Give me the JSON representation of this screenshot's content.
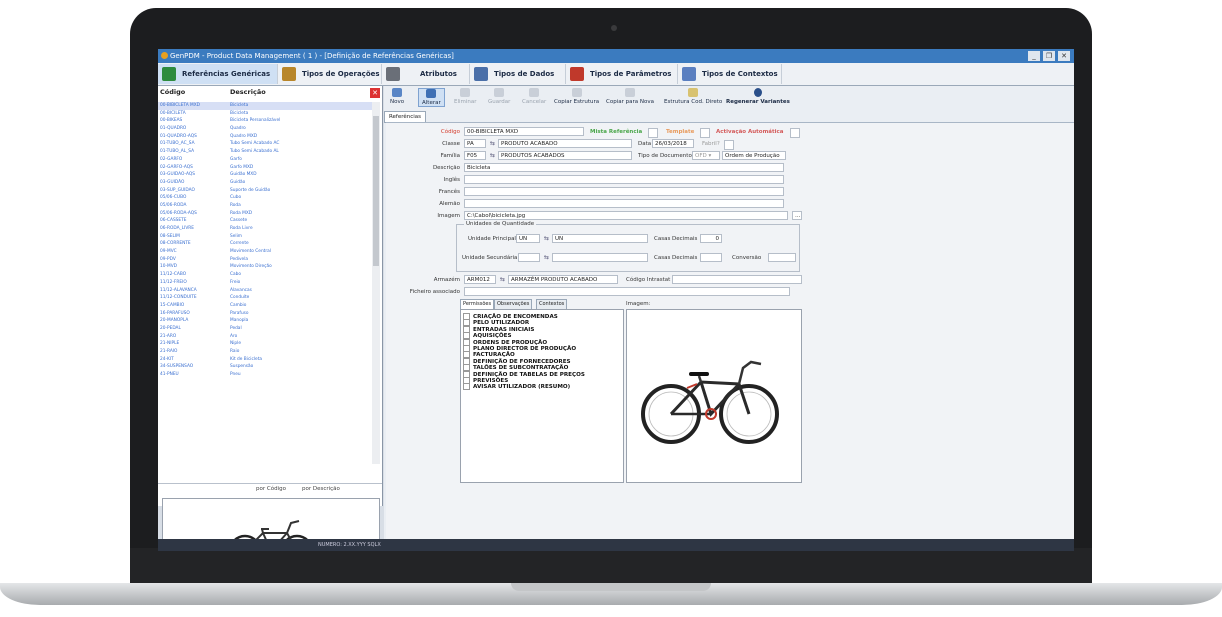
{
  "window": {
    "title": "GenPDM - Product Data Management ( 1 ) - [Definição de Referências Genéricas]",
    "controls": [
      "_",
      "❐",
      "✕"
    ]
  },
  "tabs": [
    {
      "label": "Referências Genéricas",
      "color": "#2e8b3e"
    },
    {
      "label": "Tipos de Operações",
      "color": "#b8862a"
    },
    {
      "label": "Atributos",
      "color": "#6a6f78"
    },
    {
      "label": "Tipos de Dados",
      "color": "#4a6fa8"
    },
    {
      "label": "Tipos de Parâmetros",
      "color": "#c0392b"
    },
    {
      "label": "Tipos de Contextos",
      "color": "#5a7fc0"
    }
  ],
  "left": {
    "col_code": "Código",
    "col_desc": "Descrição",
    "rows": [
      [
        "00-BIBICLETA MXD",
        "Bicicleta"
      ],
      [
        "00-BICILETA",
        "Bicicleta"
      ],
      [
        "00-BIKEAS",
        "Bicicleta Personalizável"
      ],
      [
        "01-QUADRO",
        "Quadro"
      ],
      [
        "01-QUADRO-AQS",
        "Quadro MXD"
      ],
      [
        "01-TUBO_AC_SA",
        "Tubo Semi Acabado AC"
      ],
      [
        "01-TUBO_AL_SA",
        "Tubo Semi Acabado AL"
      ],
      [
        "02-GARFO",
        "Garfo"
      ],
      [
        "02-GARFO-AQS",
        "Garfo MXD"
      ],
      [
        "03-GUIDAO-AQS",
        "Guidão MXD"
      ],
      [
        "03-GUIDÃO",
        "Guidão"
      ],
      [
        "03-SUP_GUIDAO",
        "Suporte de Guidão"
      ],
      [
        "05/06-CUBO",
        "Cubo"
      ],
      [
        "05/06-RODA",
        "Roda"
      ],
      [
        "05/06-RODA-AQS",
        "Roda MXD"
      ],
      [
        "06-CASSETE",
        "Cassete"
      ],
      [
        "06-RODA_LIVRE",
        "Roda Livre"
      ],
      [
        "08-SELIM",
        "Selim"
      ],
      [
        "08-CORRENTE",
        "Corrente"
      ],
      [
        "09-MVC",
        "Movimento Central"
      ],
      [
        "09-PDV",
        "Pedivela"
      ],
      [
        "10-MVD",
        "Movimento Direção"
      ],
      [
        "11/12-CABO",
        "Cabo"
      ],
      [
        "11/12-FREIO",
        "Freio"
      ],
      [
        "11/12-ALAVANCA",
        "Alavancas"
      ],
      [
        "11/12-CONDUITE",
        "Conduíte"
      ],
      [
        "15-CAMBIO",
        "Cambio"
      ],
      [
        "16-PARAFUSO",
        "Parafuso"
      ],
      [
        "20-MANOPLA",
        "Manopla"
      ],
      [
        "20-PEDAL",
        "Pedal"
      ],
      [
        "21-ARO",
        "Aro"
      ],
      [
        "21-NIPLE",
        "Niple"
      ],
      [
        "21-RAIO",
        "Raio"
      ],
      [
        "24-KIT",
        "Kit de Bicicleta"
      ],
      [
        "34-SUSPENSAO",
        "Suspensão"
      ],
      [
        "41-PNEU",
        "Pneu"
      ]
    ],
    "sort_code": "por Código",
    "sort_desc": "por Descrição"
  },
  "toolbar": {
    "items": [
      "Novo",
      "Alterar",
      "Eliminar",
      "Guardar",
      "Cancelar",
      "Copiar Estrutura",
      "Copiar para Nova",
      "Estrutura Cod. Direto",
      "Regenerar Variantes"
    ],
    "subtab": "Referências"
  },
  "form": {
    "codigo_label": "Código",
    "codigo": "00-BIBICLETA MXD",
    "mista_label": "Mista Referência",
    "template_label": "Template",
    "ativacao_label": "Activação Automática",
    "classe_label": "Classe",
    "classe_code": "PA",
    "classe_desc": "PRODUTO ACABADO",
    "data_label": "Data",
    "data": "26/03/2018",
    "fabril_label": "Fabril?",
    "familia_label": "Família",
    "familia_code": "F05",
    "familia_desc": "PRODUTOS ACABADOS",
    "tipodoc_label": "Tipo de Documento",
    "tipodoc_code": "OFD",
    "tipodoc_desc": "Ordem de Produção",
    "descricao_label": "Descrição",
    "descricao": "Bicicleta",
    "ingles_label": "Inglês",
    "frances_label": "Francês",
    "alemao_label": "Alemão",
    "imagem_label": "Imagem",
    "imagem": "C:\\Cabol\\bicicleta.jpg",
    "unidades_title": "Unidades de Quantidade",
    "unid_principal_label": "Unidade Principal",
    "unid_principal": "UN",
    "unid_principal_desc": "UN",
    "casas_label": "Casas Decimais",
    "casas_principal": "0",
    "unid_secundaria_label": "Unidade Secundária",
    "conversao_label": "Conversão",
    "armazem_label": "Armazém",
    "armazem_code": "ARM012",
    "armazem_desc": "ARMAZÉM PRODUTO ACABADO",
    "codigo_intrastat_label": "Código Intrastat",
    "ficheiro_label": "Ficheiro associado",
    "imagem_title": "Imagem:",
    "ptabs": [
      "Permissões",
      "Observações",
      "Contextos"
    ],
    "permissions": [
      "CRIAÇÃO DE ENCOMENDAS",
      "PELO UTILIZADOR",
      "ENTRADAS INICIAIS",
      "AQUISIÇÕES",
      "ORDENS DE PRODUÇÃO",
      "PLANO DIRECTOR DE PRODUÇÃO",
      "FACTURAÇÃO",
      "DEFINIÇÃO DE FORNECEDORES",
      "TALÕES DE SUBCONTRATAÇÃO",
      "DEFINIÇÃO DE TABELAS DE PREÇOS",
      "PREVISÕES",
      "AVISAR UTILIZADOR (RESUMO)"
    ]
  },
  "status": {
    "text": "NUMERO: 2.XX.YYY  SQLX"
  },
  "colors": {
    "titlebar": "#3b7bbf",
    "link": "#3a6fd0",
    "bezel": "#1c1d1f"
  }
}
